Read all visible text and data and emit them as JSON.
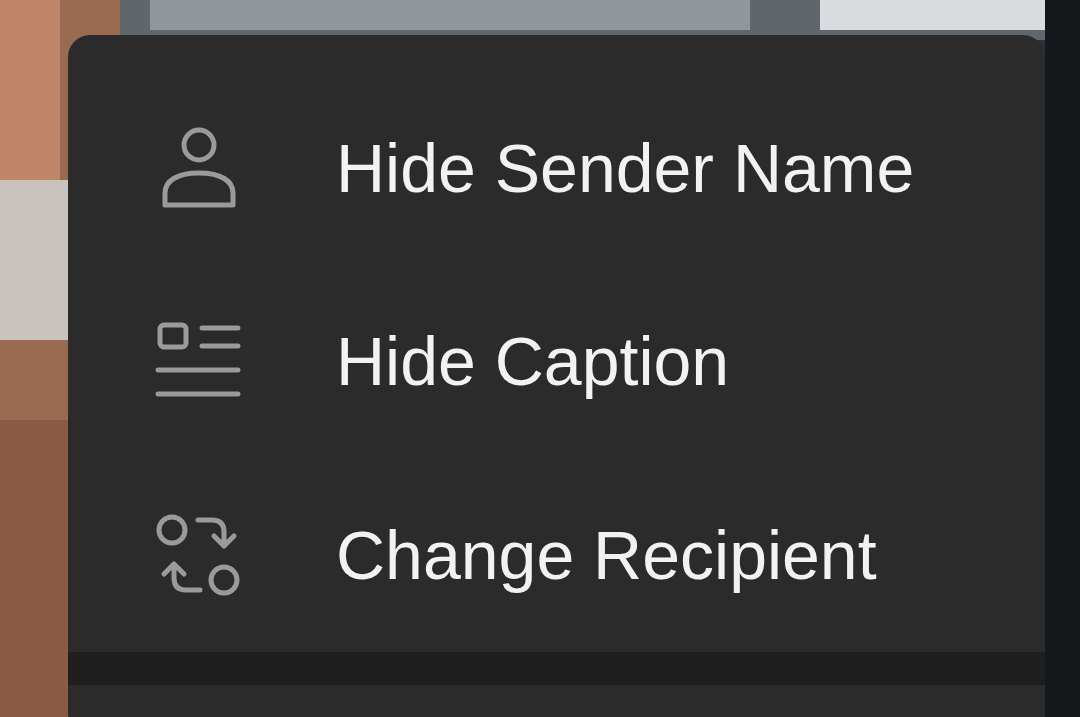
{
  "menu": {
    "items": [
      {
        "kind": "sender",
        "label": "Hide Sender Name"
      },
      {
        "kind": "caption",
        "label": "Hide Caption"
      },
      {
        "kind": "recipient",
        "label": "Change Recipient"
      }
    ]
  }
}
